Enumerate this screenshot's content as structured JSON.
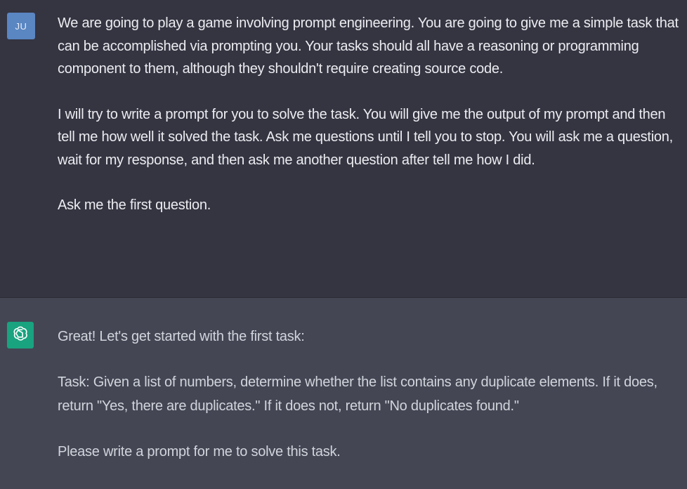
{
  "conversation": {
    "user": {
      "avatar_initials": "JU",
      "paragraphs": [
        "We are going to play a game involving prompt engineering. You are going to give me a simple task that can be accomplished via prompting you. Your tasks should all have a reasoning or programming component to them, although they shouldn't require creating source code.",
        "I will try to write a prompt for you to solve the task. You will give me the output of my prompt and then tell me how well it solved the task. Ask me questions until I tell you to stop. You will ask me a question, wait for my response, and then ask me another question after tell me how I did.",
        "Ask me the first question."
      ]
    },
    "assistant": {
      "avatar_icon": "openai-logo-icon",
      "paragraphs": [
        "Great! Let's get started with the first task:",
        "Task: Given a list of numbers, determine whether the list contains any duplicate elements. If it does, return \"Yes, there are duplicates.\" If it does not, return \"No duplicates found.\"",
        "Please write a prompt for me to solve this task."
      ]
    }
  },
  "colors": {
    "user_bg": "#343541",
    "assistant_bg": "#444654",
    "user_avatar": "#5a86c2",
    "assistant_avatar": "#19a37f",
    "text": "#ececf1"
  }
}
